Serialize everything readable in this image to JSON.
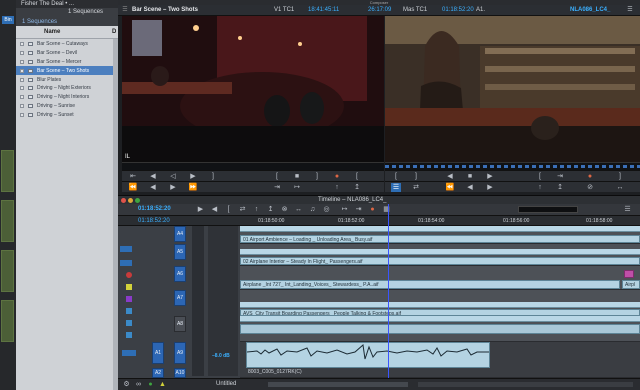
{
  "left_strip": {
    "tab_label": "Bin"
  },
  "bin": {
    "title": "Fisher The Deal • ...",
    "sequences_count": "1 Sequences",
    "sub_tab": "1 Sequences",
    "column_name": "Name",
    "column_extra": "D",
    "items": [
      {
        "label": "Bar Scene – Cutaways",
        "selected": false
      },
      {
        "label": "Bar Scene – Devil",
        "selected": false
      },
      {
        "label": "Bar Scene – Mercer",
        "selected": false
      },
      {
        "label": "Bar Scene – Two Shots",
        "selected": true
      },
      {
        "label": "Blur Plates",
        "selected": false
      },
      {
        "label": "Driving – Night Exteriors",
        "selected": false
      },
      {
        "label": "Driving – Night Interiors",
        "selected": false
      },
      {
        "label": "Driving – Sunrise",
        "selected": false
      },
      {
        "label": "Driving – Sunset",
        "selected": false
      }
    ]
  },
  "composer": {
    "title": "Composer",
    "source_name": "Bar Scene – Two Shots",
    "v1_label": "V1 TC1",
    "source_tc": "18:41:45:11",
    "duration": "26:17:09",
    "mas_label": "Mas TC1",
    "record_tc": "01:18:52:20",
    "record_track": "A1.",
    "sequence_name": "NLA086_LC4_",
    "source_overlay": "IL"
  },
  "timeline": {
    "title": "Timeline – NLA086_LC4_",
    "current_tc": "01:18:52:20",
    "ruler_ticks": [
      "01:18:50:00",
      "01:18:52:00",
      "01:18:54:00",
      "01:18:56:00",
      "01:18:58:00"
    ],
    "tracks": [
      {
        "label": "A4",
        "clip": "01 Airport Ambience – Loading _ Unloading Area_ Busy.aif"
      },
      {
        "label": "A5",
        "clip": "02 Airplane Interior – Steady In Flight_ Passengers.aif"
      },
      {
        "label": "A6",
        "clip": "Airplane _Int 727_ Int_Landing_Voices_ Stewardess_ P.A..aif",
        "clip2": "Airpl"
      },
      {
        "label": "A7",
        "clip": "AVS_City Transit Boarding Passengers_ People Talking & Footsteps.aif"
      },
      {
        "label": "A8",
        "clip": ""
      },
      {
        "label": "A9",
        "clip": "8003_C005_0127RK(C)",
        "source": "A1"
      },
      {
        "label": "A10",
        "clip": "",
        "source": "A2"
      }
    ],
    "volume": "–8.0 dB",
    "status_label": "Untitled"
  },
  "colors": {
    "accent": "#3bb0ff",
    "selected_row": "#4c7fbf",
    "audio_clip": "#b4d3e2",
    "playhead": "#3a55ff",
    "track_on": "#2c66b4"
  }
}
